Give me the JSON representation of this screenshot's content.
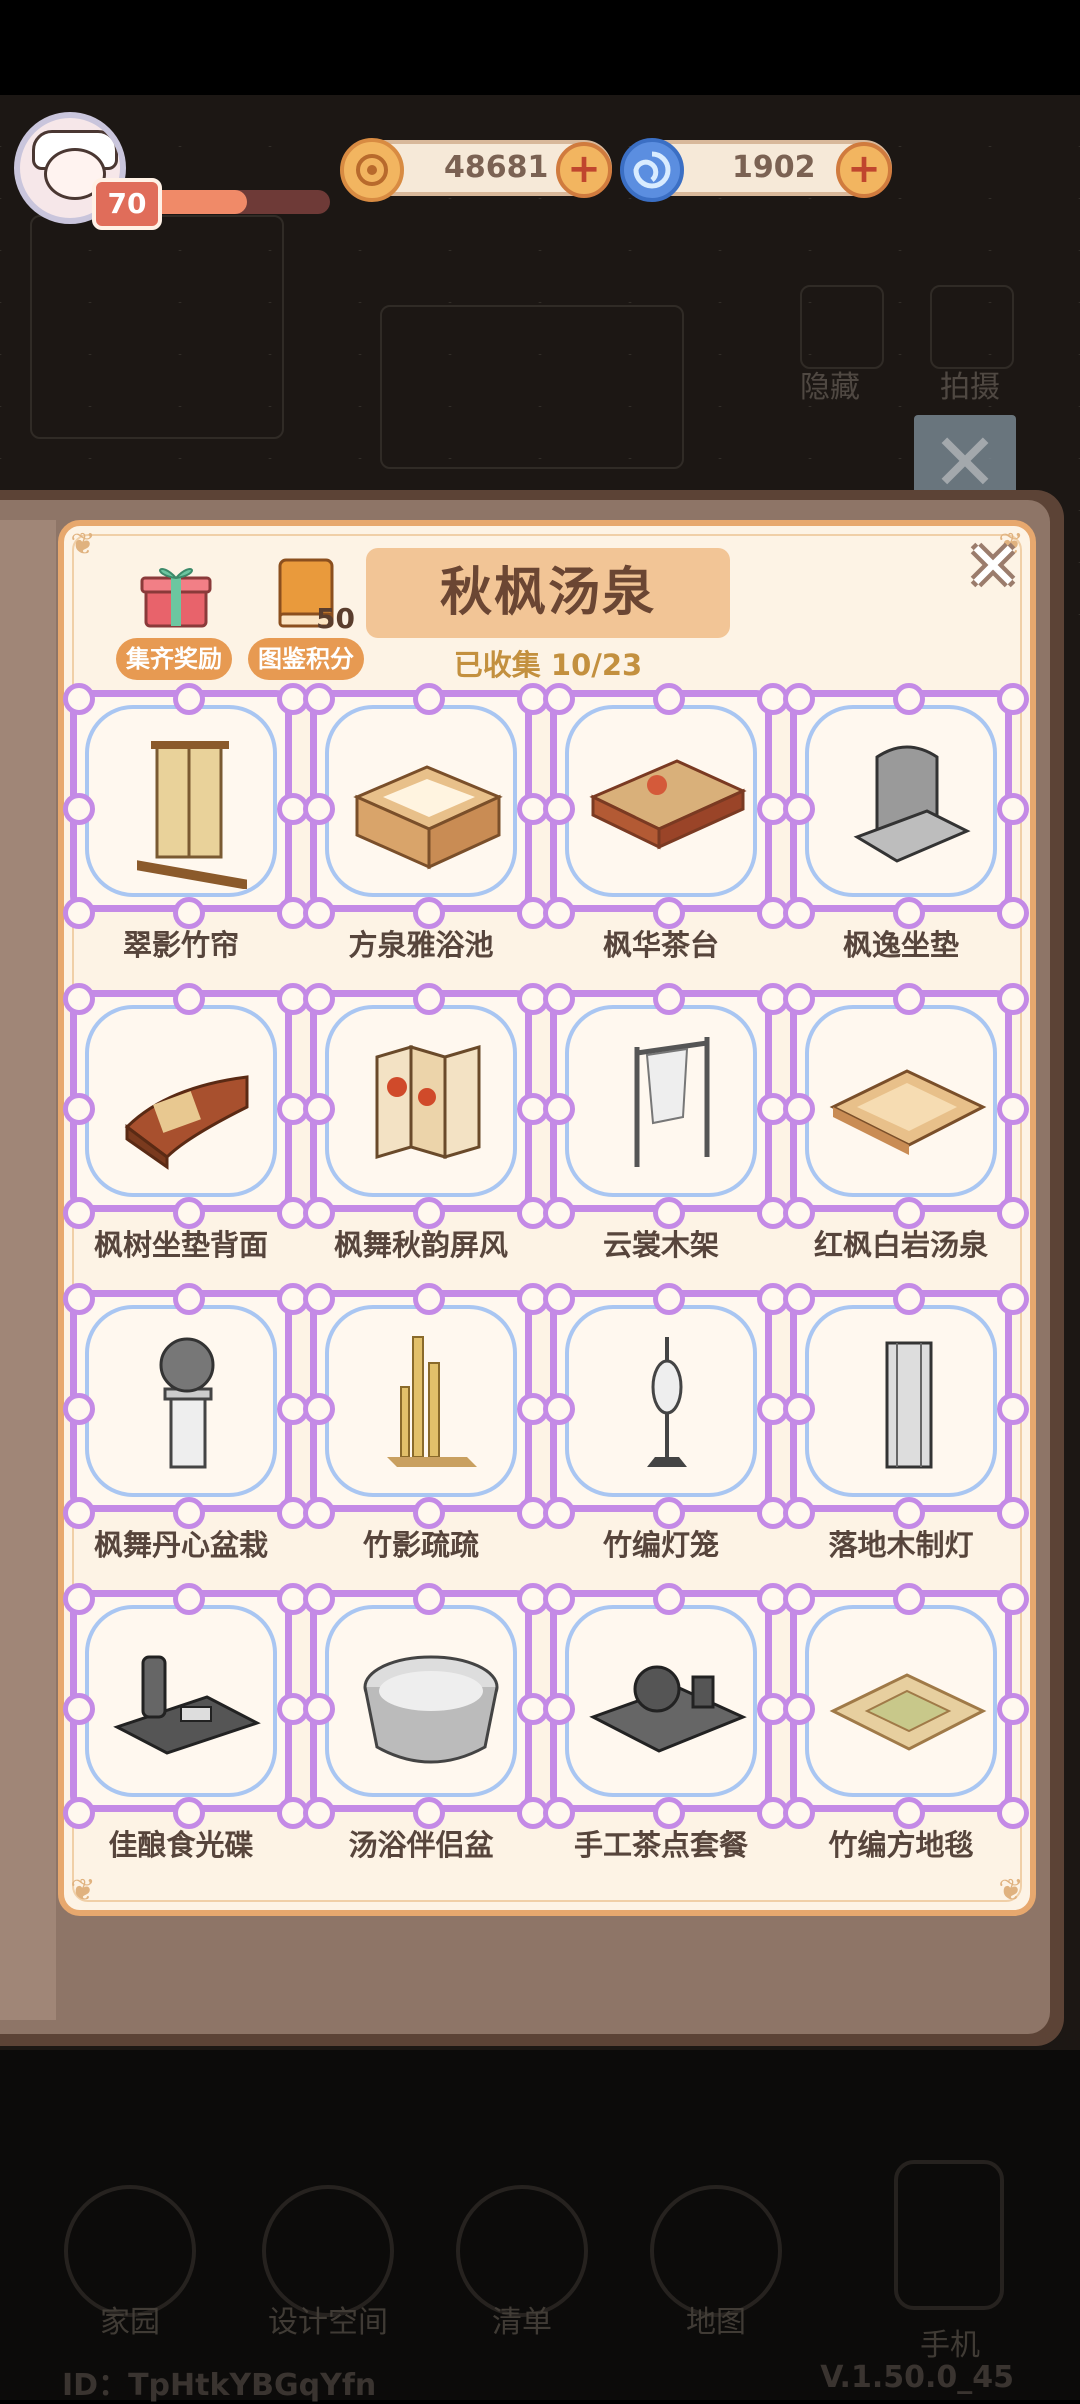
{
  "header": {
    "level": "70",
    "xp_fraction": 0.55,
    "coins": "48681",
    "gems": "1902"
  },
  "background_labels": [
    "隐藏",
    "拍摄"
  ],
  "panel": {
    "title": "秋枫汤泉",
    "collected": "已收集 10/23",
    "reward_label": "集齐奖励",
    "score_label": "图鉴积分",
    "score_value": "50"
  },
  "items": [
    {
      "name": "翠影竹帘",
      "icon": "bamboo-curtain-icon"
    },
    {
      "name": "方泉雅浴池",
      "icon": "square-bath-icon"
    },
    {
      "name": "枫华茶台",
      "icon": "tea-table-icon"
    },
    {
      "name": "枫逸坐垫",
      "icon": "seat-cushion-icon"
    },
    {
      "name": "枫树坐垫背面",
      "icon": "cushion-back-icon"
    },
    {
      "name": "枫舞秋韵屏风",
      "icon": "folding-screen-icon"
    },
    {
      "name": "云裳木架",
      "icon": "clothes-rack-icon"
    },
    {
      "name": "红枫白岩汤泉",
      "icon": "hot-spring-pool-icon"
    },
    {
      "name": "枫舞丹心盆栽",
      "icon": "potted-plant-icon"
    },
    {
      "name": "竹影疏疏",
      "icon": "bamboo-decor-icon"
    },
    {
      "name": "竹编灯笼",
      "icon": "bamboo-lantern-icon"
    },
    {
      "name": "落地木制灯",
      "icon": "floor-lamp-icon"
    },
    {
      "name": "佳酿食光碟",
      "icon": "sake-tray-icon"
    },
    {
      "name": "汤浴伴侣盆",
      "icon": "bath-tub-icon"
    },
    {
      "name": "手工茶点套餐",
      "icon": "tea-set-icon"
    },
    {
      "name": "竹编方地毯",
      "icon": "bamboo-rug-icon"
    }
  ],
  "nav": [
    "家园",
    "设计空间",
    "清单",
    "地图",
    "手机"
  ],
  "footer": {
    "id": "ID：TpHtkYBGqYfn",
    "version": "V.1.50.0_45"
  },
  "colors": {
    "panel_bg": "#fdf3e5",
    "panel_border": "#e7a86e",
    "title_bg": "#f2c596",
    "frame_purple": "#c48ae6",
    "frame_blue": "#a9c6f2",
    "accent_orange": "#e79a52"
  }
}
